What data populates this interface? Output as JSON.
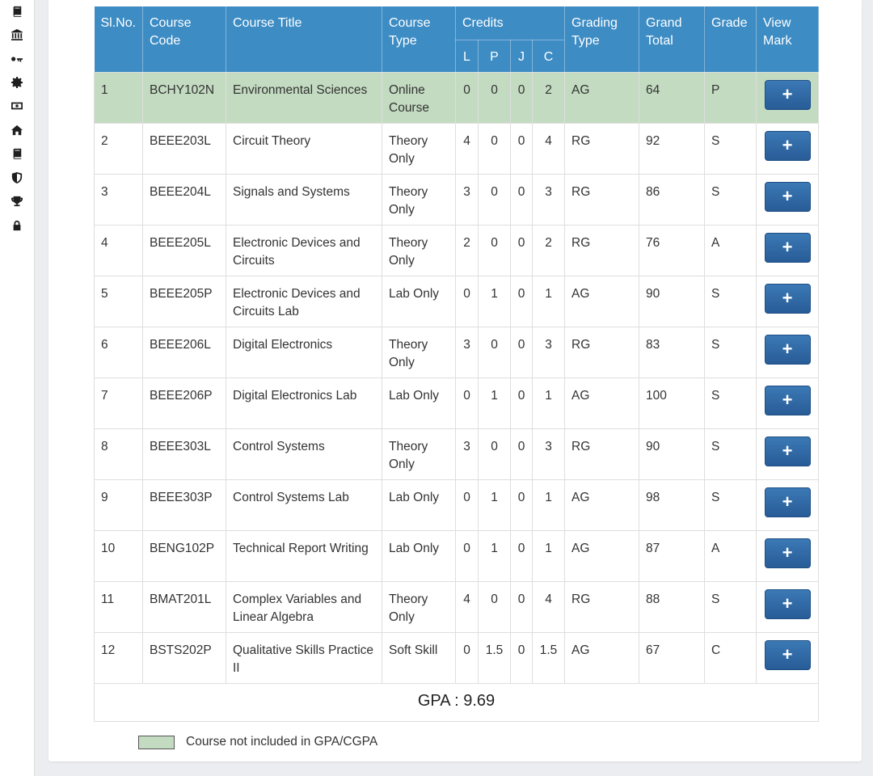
{
  "headers": {
    "slno": "Sl.No.",
    "course_code": "Course Code",
    "course_title": "Course Title",
    "course_type": "Course Type",
    "credits": "Credits",
    "credit_l": "L",
    "credit_p": "P",
    "credit_j": "J",
    "credit_c": "C",
    "grading_type": "Grading Type",
    "grand_total": "Grand Total",
    "grade": "Grade",
    "view_mark": "View Mark"
  },
  "rows": [
    {
      "slno": "1",
      "code": "BCHY102N",
      "title": "Environmental Sciences",
      "type": "Online Course",
      "l": "0",
      "p": "0",
      "j": "0",
      "c": "2",
      "grading": "AG",
      "total": "64",
      "grade": "P",
      "excluded": true
    },
    {
      "slno": "2",
      "code": "BEEE203L",
      "title": "Circuit Theory",
      "type": "Theory Only",
      "l": "4",
      "p": "0",
      "j": "0",
      "c": "4",
      "grading": "RG",
      "total": "92",
      "grade": "S",
      "excluded": false
    },
    {
      "slno": "3",
      "code": "BEEE204L",
      "title": "Signals and Systems",
      "type": "Theory Only",
      "l": "3",
      "p": "0",
      "j": "0",
      "c": "3",
      "grading": "RG",
      "total": "86",
      "grade": "S",
      "excluded": false
    },
    {
      "slno": "4",
      "code": "BEEE205L",
      "title": "Electronic Devices and Circuits",
      "type": "Theory Only",
      "l": "2",
      "p": "0",
      "j": "0",
      "c": "2",
      "grading": "RG",
      "total": "76",
      "grade": "A",
      "excluded": false
    },
    {
      "slno": "5",
      "code": "BEEE205P",
      "title": "Electronic Devices and Circuits Lab",
      "type": "Lab Only",
      "l": "0",
      "p": "1",
      "j": "0",
      "c": "1",
      "grading": "AG",
      "total": "90",
      "grade": "S",
      "excluded": false
    },
    {
      "slno": "6",
      "code": "BEEE206L",
      "title": "Digital Electronics",
      "type": "Theory Only",
      "l": "3",
      "p": "0",
      "j": "0",
      "c": "3",
      "grading": "RG",
      "total": "83",
      "grade": "S",
      "excluded": false
    },
    {
      "slno": "7",
      "code": "BEEE206P",
      "title": "Digital Electronics Lab",
      "type": "Lab Only",
      "l": "0",
      "p": "1",
      "j": "0",
      "c": "1",
      "grading": "AG",
      "total": "100",
      "grade": "S",
      "excluded": false
    },
    {
      "slno": "8",
      "code": "BEEE303L",
      "title": "Control Systems",
      "type": "Theory Only",
      "l": "3",
      "p": "0",
      "j": "0",
      "c": "3",
      "grading": "RG",
      "total": "90",
      "grade": "S",
      "excluded": false
    },
    {
      "slno": "9",
      "code": "BEEE303P",
      "title": "Control Systems Lab",
      "type": "Lab Only",
      "l": "0",
      "p": "1",
      "j": "0",
      "c": "1",
      "grading": "AG",
      "total": "98",
      "grade": "S",
      "excluded": false
    },
    {
      "slno": "10",
      "code": "BENG102P",
      "title": "Technical Report Writing",
      "type": "Lab Only",
      "l": "0",
      "p": "1",
      "j": "0",
      "c": "1",
      "grading": "AG",
      "total": "87",
      "grade": "A",
      "excluded": false
    },
    {
      "slno": "11",
      "code": "BMAT201L",
      "title": "Complex Variables and Linear Algebra",
      "type": "Theory Only",
      "l": "4",
      "p": "0",
      "j": "0",
      "c": "4",
      "grading": "RG",
      "total": "88",
      "grade": "S",
      "excluded": false
    },
    {
      "slno": "12",
      "code": "BSTS202P",
      "title": "Qualitative Skills Practice II",
      "type": "Soft Skill",
      "l": "0",
      "p": "1.5",
      "j": "0",
      "c": "1.5",
      "grading": "AG",
      "total": "67",
      "grade": "C",
      "excluded": false
    }
  ],
  "view_button_label": "+",
  "gpa_text": "GPA : 9.69",
  "legend": {
    "text": "Course not included in GPA/CGPA",
    "color": "#c3dbc1"
  },
  "sidebar_icons": [
    "book-icon",
    "bank-icon",
    "key-icon",
    "gear-icon",
    "money-icon",
    "home-icon",
    "book-icon",
    "shield-icon",
    "trophy-icon",
    "lock-icon"
  ],
  "colors": {
    "header_bg": "#3d8cc4",
    "button_bg": "#2f6aa6",
    "excluded_row": "#c3dbc1"
  }
}
